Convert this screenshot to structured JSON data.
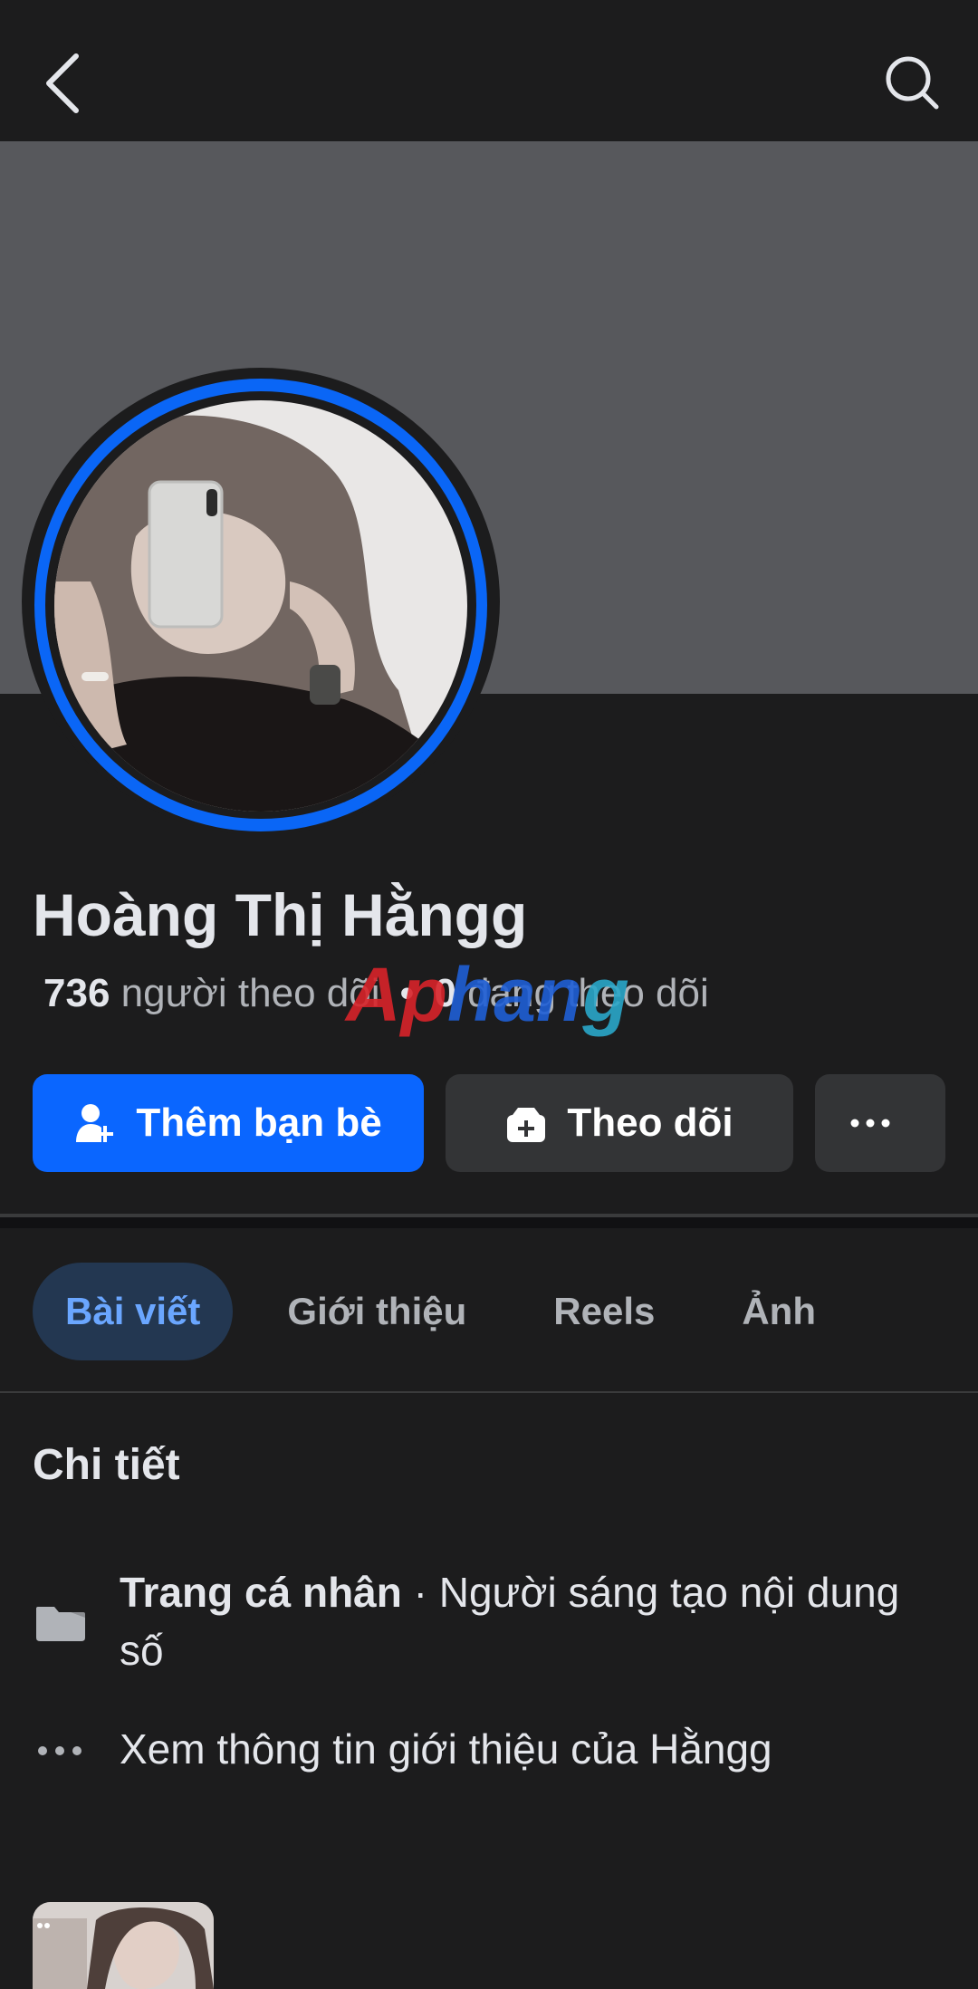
{
  "profile": {
    "name": "Hoàng Thị Hằngg",
    "followers_count": "736",
    "followers_label": "người theo dõi",
    "separator": "•",
    "following_count": "0",
    "following_label": "đang theo dõi"
  },
  "watermark": {
    "part1": "Ap",
    "part2": "han",
    "part3": "g"
  },
  "actions": {
    "add_friend_label": "Thêm bạn bè",
    "follow_label": "Theo dõi",
    "more_label": "···"
  },
  "tabs": [
    {
      "label": "Bài viết",
      "active": true
    },
    {
      "label": "Giới thiệu",
      "active": false
    },
    {
      "label": "Reels",
      "active": false
    },
    {
      "label": "Ảnh",
      "active": false
    }
  ],
  "details": {
    "title": "Chi tiết",
    "category_label": "Trang cá nhân",
    "category_separator": " · ",
    "category_value": "Người sáng tạo nội dung số",
    "see_about": "Xem thông tin giới thiệu của Hằngg"
  },
  "colors": {
    "background": "#1c1c1d",
    "cover": "#57585c",
    "primary_blue": "#0a66ff",
    "secondary_button": "#333436",
    "active_tab_bg": "#233751",
    "active_tab_text": "#6aa6ff",
    "muted_text": "#b0b3b8"
  },
  "icons": {
    "back": "chevron-left-icon",
    "search": "search-icon",
    "add_friend": "person-add-icon",
    "follow": "follow-bag-icon",
    "page": "page-flag-icon",
    "more": "more-dots-icon"
  }
}
